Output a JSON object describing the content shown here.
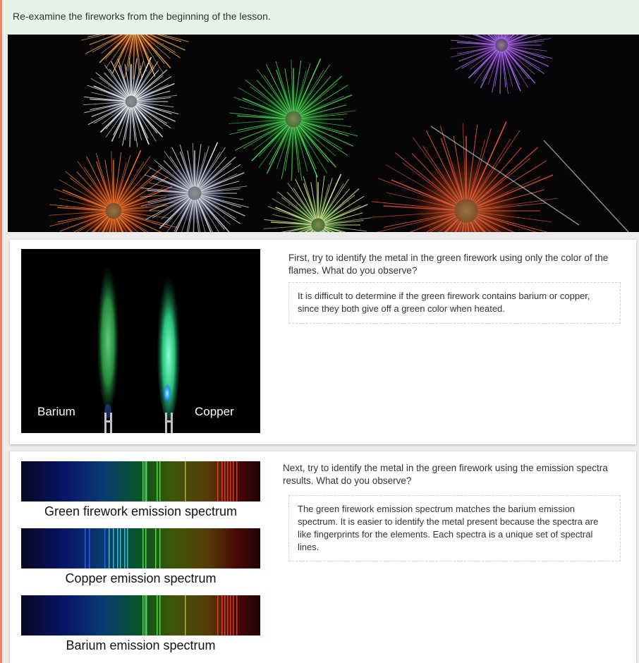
{
  "prompt": {
    "text": "Re-examine the fireworks from the beginning of the lesson."
  },
  "flames": {
    "barium_label": "Barium",
    "copper_label": "Copper"
  },
  "question1": {
    "text": "First, try to identify the metal in the green firework using only the color of the flames. What do you observe?",
    "answer": "It is difficult to determine if the green firework contains barium or copper, since they both give off a green color when heated."
  },
  "spectra": [
    {
      "caption": "Green firework emission spectrum"
    },
    {
      "caption": "Copper emission spectrum"
    },
    {
      "caption": "Barium emission spectrum"
    }
  ],
  "question2": {
    "text": "Next, try to identify the metal in the green firework using the emission spectra results. What do you observe?",
    "answer": "The green firework emission spectrum matches the barium emission spectrum. It is easier to identify the metal present because the spectra are like fingerprints for the elements. Each spectra is a unique set of spectral lines."
  },
  "colors": {
    "prompt_bg": "#e6f3e8",
    "accent": "#e8886a",
    "barium_flame": "#2faa4a",
    "copper_flame": "#35d58a"
  }
}
